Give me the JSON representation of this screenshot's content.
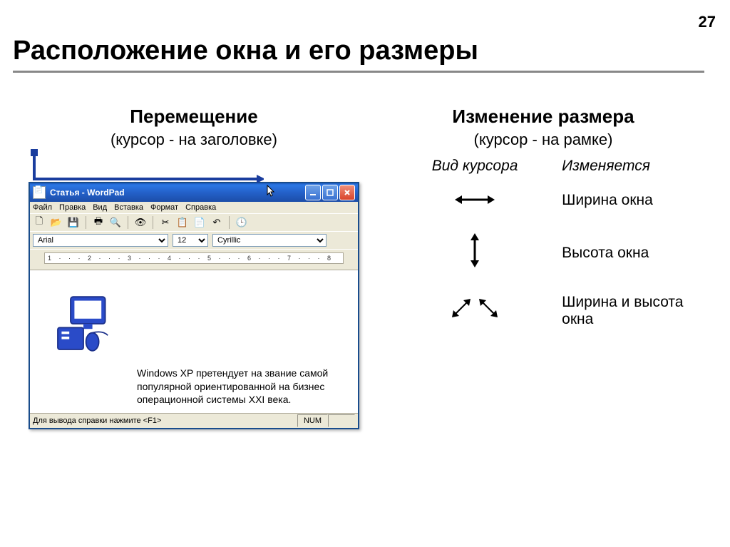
{
  "page": {
    "number": "27",
    "title": "Расположение окна и его размеры"
  },
  "left": {
    "title": "Перемещение",
    "subtitle": "(курсор - на заголовке)"
  },
  "right": {
    "title": "Изменение размера",
    "subtitle": "(курсор - на рамке)",
    "header_cursor": "Вид курсора",
    "header_changes": "Изменяется",
    "rows": [
      {
        "desc": "Ширина окна"
      },
      {
        "desc": "Высота окна"
      },
      {
        "desc": "Ширина и высота окна"
      }
    ]
  },
  "wordpad": {
    "title": "Статья - WordPad",
    "menu": [
      "Файл",
      "Правка",
      "Вид",
      "Вставка",
      "Формат",
      "Справка"
    ],
    "font_name": "Arial",
    "font_size": "12",
    "charset": "Cyrillic",
    "ruler": "1 · · · 2 · · · 3 · · · 4 · · · 5 · · · 6 · · · 7 · · · 8",
    "doc_text": "Windows XP претендует на звание самой популярной ориентированной на бизнес операционной системы XXI века.",
    "status_left": "Для вывода справки нажмите <F1>",
    "status_num": "NUM"
  }
}
